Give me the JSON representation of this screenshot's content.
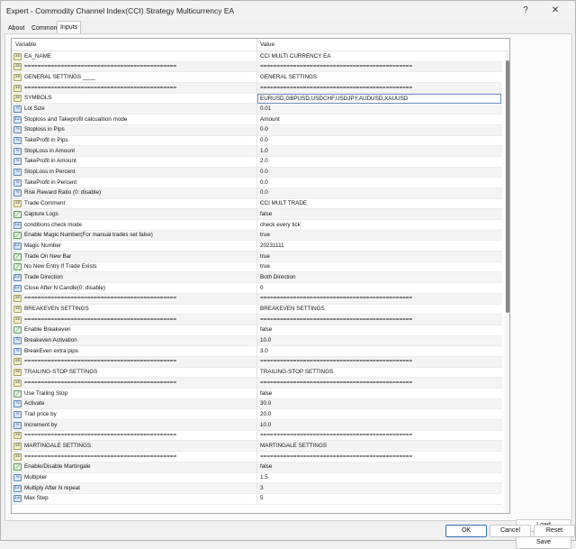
{
  "window": {
    "title": "Expert - Commodity Channel Index(CCI) Strategy Multicurrency EA",
    "help_glyph": "?",
    "close_glyph": "✕"
  },
  "tabs": [
    {
      "label": "About"
    },
    {
      "label": "Common"
    },
    {
      "label": "Inputs"
    }
  ],
  "grid": {
    "col_variable": "Variable",
    "col_value": "Value",
    "rows": [
      {
        "icon": "ab",
        "glyph": "ab",
        "variable": "EA_NAME",
        "value": "CCI MULTI CURRENCY EA"
      },
      {
        "icon": "ab",
        "glyph": "ab",
        "variable": "==============================================",
        "value": "=============================================="
      },
      {
        "icon": "ab",
        "glyph": "ab",
        "variable": "GENERAL SETTINGS ____",
        "value": "GENERAL SETTINGS"
      },
      {
        "icon": "ab",
        "glyph": "ab",
        "variable": "==============================================",
        "value": "=============================================="
      },
      {
        "icon": "ab",
        "glyph": "ab",
        "variable": "SYMBOLS",
        "value": "EURUSD,GBPUSD,USDCHF,USDJPY,AUDUSD,XAUUSD"
      },
      {
        "icon": "num",
        "glyph": "½",
        "variable": "Lot Size",
        "value": "0.01"
      },
      {
        "icon": "num",
        "glyph": "123",
        "variable": "Stoploss and Takeprofit calcualtion mode",
        "value": "Amount"
      },
      {
        "icon": "num",
        "glyph": "½",
        "variable": "Stoploss in Pips",
        "value": "0.0"
      },
      {
        "icon": "num",
        "glyph": "½",
        "variable": "TakeProfit in Pips",
        "value": "0.0"
      },
      {
        "icon": "num",
        "glyph": "½",
        "variable": "StopLoss in Amount",
        "value": "1.0"
      },
      {
        "icon": "num",
        "glyph": "½",
        "variable": "TakeProfit in Amount",
        "value": "2.0"
      },
      {
        "icon": "num",
        "glyph": "½",
        "variable": "StopLoss in Percent",
        "value": "0.0"
      },
      {
        "icon": "num",
        "glyph": "½",
        "variable": "TakeProfit in Percent",
        "value": "0.0"
      },
      {
        "icon": "num",
        "glyph": "½",
        "variable": "Risk Reward Ratio (0: disable)",
        "value": "0.0"
      },
      {
        "icon": "ab",
        "glyph": "ab",
        "variable": "Trade Comment",
        "value": "CCI MULT TRADE"
      },
      {
        "icon": "bool",
        "glyph": "⟋",
        "variable": "Capture Logs",
        "value": "false"
      },
      {
        "icon": "num",
        "glyph": "123",
        "variable": "conditions check mode",
        "value": "check every tick"
      },
      {
        "icon": "bool",
        "glyph": "⟋",
        "variable": "Enable Magic Number(For manual trades set false)",
        "value": "true"
      },
      {
        "icon": "num",
        "glyph": "123",
        "variable": "Magic Number",
        "value": "20231111"
      },
      {
        "icon": "bool",
        "glyph": "⟋",
        "variable": "Trade On New Bar",
        "value": "true"
      },
      {
        "icon": "bool",
        "glyph": "⟋",
        "variable": "No New Entry If Trade Exists",
        "value": "true"
      },
      {
        "icon": "num",
        "glyph": "123",
        "variable": "Trade Direction",
        "value": "Both Direction"
      },
      {
        "icon": "num",
        "glyph": "123",
        "variable": "Close After N Candle(0: disable)",
        "value": "0"
      },
      {
        "icon": "ab",
        "glyph": "ab",
        "variable": "==============================================",
        "value": "=============================================="
      },
      {
        "icon": "ab",
        "glyph": "ab",
        "variable": "BREAKEVEN SETTINGS",
        "value": "BREAKEVEN SETTINGS"
      },
      {
        "icon": "ab",
        "glyph": "ab",
        "variable": "==============================================",
        "value": "=============================================="
      },
      {
        "icon": "bool",
        "glyph": "⟋",
        "variable": "Enable Breakeven",
        "value": "false"
      },
      {
        "icon": "num",
        "glyph": "½",
        "variable": "Breakeven Activation",
        "value": "10.0"
      },
      {
        "icon": "num",
        "glyph": "½",
        "variable": "BreakEven extra pips",
        "value": "3.0"
      },
      {
        "icon": "ab",
        "glyph": "ab",
        "variable": "==============================================",
        "value": "=============================================="
      },
      {
        "icon": "ab",
        "glyph": "ab",
        "variable": "TRAILING-STOP SETTINGS",
        "value": "TRAILING-STOP SETTINGS"
      },
      {
        "icon": "ab",
        "glyph": "ab",
        "variable": "==============================================",
        "value": "=============================================="
      },
      {
        "icon": "bool",
        "glyph": "⟋",
        "variable": "Use Trailing Stop",
        "value": "false"
      },
      {
        "icon": "num",
        "glyph": "½",
        "variable": "Activate",
        "value": "30.0"
      },
      {
        "icon": "num",
        "glyph": "½",
        "variable": "Trail price by",
        "value": "20.0"
      },
      {
        "icon": "num",
        "glyph": "½",
        "variable": "Increment by",
        "value": "10.0"
      },
      {
        "icon": "ab",
        "glyph": "ab",
        "variable": "==============================================",
        "value": "=============================================="
      },
      {
        "icon": "ab",
        "glyph": "ab",
        "variable": "MARTINGALE SETTINGS",
        "value": "MARTINGALE SETTINGS"
      },
      {
        "icon": "ab",
        "glyph": "ab",
        "variable": "==============================================",
        "value": "=============================================="
      },
      {
        "icon": "bool",
        "glyph": "⟋",
        "variable": "Enable/Disable Martingale",
        "value": "false"
      },
      {
        "icon": "num",
        "glyph": "½",
        "variable": "Multiplier",
        "value": "1.5"
      },
      {
        "icon": "num",
        "glyph": "123",
        "variable": "Multiply After N repeat",
        "value": "3"
      },
      {
        "icon": "num",
        "glyph": "123",
        "variable": "Max Step",
        "value": "5"
      }
    ]
  },
  "buttons": {
    "load": "Load",
    "save": "Save",
    "ok": "OK",
    "cancel": "Cancel",
    "reset": "Reset"
  }
}
